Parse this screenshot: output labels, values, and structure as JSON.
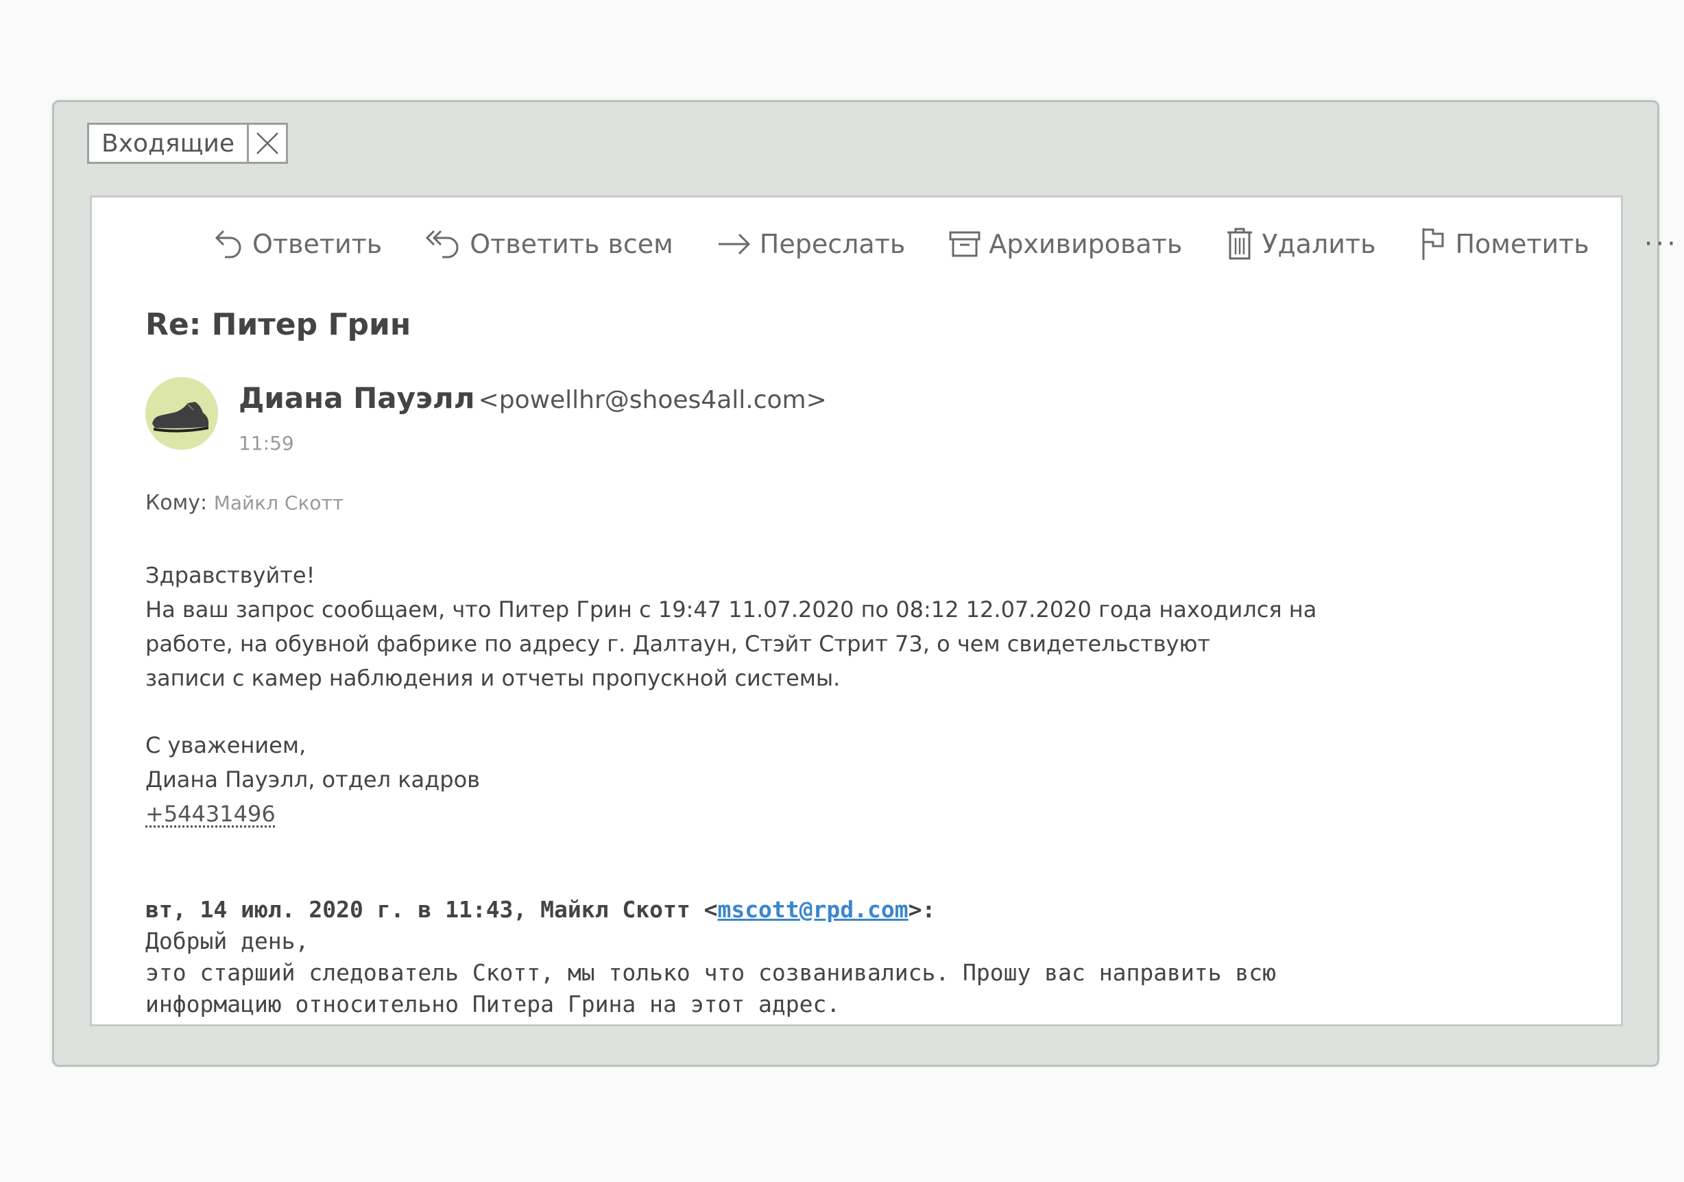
{
  "tab": {
    "label": "Входящие"
  },
  "toolbar": {
    "reply": "Ответить",
    "reply_all": "Ответить всем",
    "forward": "Переслать",
    "archive": "Архивировать",
    "delete": "Удалить",
    "flag": "Пометить",
    "more": "···"
  },
  "message": {
    "subject": "Re: Питер Грин",
    "sender_name": "Диана Пауэлл",
    "sender_email": "<powellhr@shoes4all.com>",
    "time": "11:59",
    "to_label": "Кому:",
    "to_value": "Майкл Скотт",
    "body": {
      "greeting": "Здравствуйте!",
      "line1": "На ваш запрос сообщаем, что Питер Грин с 19:47 11.07.2020 по 08:12 12.07.2020 года находился на",
      "line2": "работе, на обувной фабрике по адресу г. Далтаун,  Стэйт Стрит 73, о чем свидетельствуют",
      "line3": "записи с камер наблюдения и отчеты пропускной системы.",
      "closing": "С уважением,",
      "signature": "Диана Пауэлл, отдел кадров",
      "phone": "+54431496"
    },
    "quoted": {
      "header_prefix": "вт, 14 июл. 2020 г. в 11:43, Майкл Скотт <",
      "header_email": "mscott@rpd.com",
      "header_suffix": ">:",
      "line1": "Добрый день,",
      "line2": "это старший следователь Скотт, мы только что созванивались. Прошу вас направить всю",
      "line3": "информацию относительно Питера Грина на этот адрес."
    }
  },
  "colors": {
    "window_frame": "#dde2de",
    "panel": "#ffffff",
    "text": "#444444",
    "muted": "#999999",
    "link": "#3a86d0",
    "avatar_bg": "#dbe6a8"
  }
}
